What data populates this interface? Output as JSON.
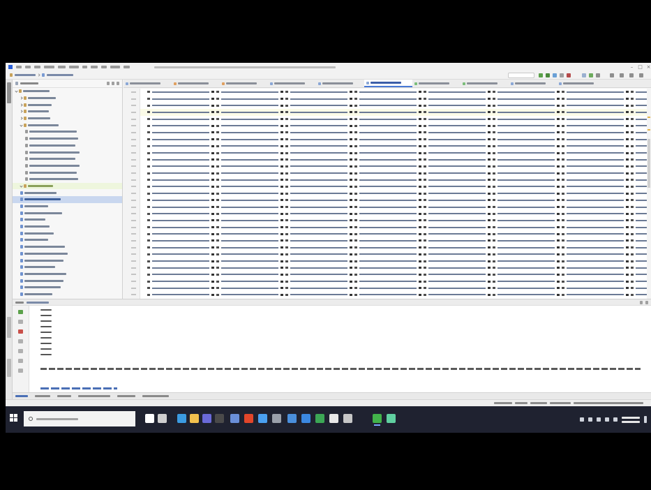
{
  "window": {
    "title": ""
  },
  "menu": {
    "items": [
      "",
      "",
      "",
      "",
      "",
      "",
      "",
      "",
      "",
      "",
      "",
      ""
    ]
  },
  "breadcrumb": [
    "",
    ""
  ],
  "project": {
    "header": "",
    "tree": [
      {
        "label": "",
        "depth": 0,
        "kind": "folder-open"
      },
      {
        "label": "",
        "depth": 1,
        "kind": "folder"
      },
      {
        "label": "",
        "depth": 1,
        "kind": "folder"
      },
      {
        "label": "",
        "depth": 1,
        "kind": "folder"
      },
      {
        "label": "",
        "depth": 1,
        "kind": "folder"
      },
      {
        "label": "",
        "depth": 1,
        "kind": "folder-open"
      },
      {
        "label": "",
        "depth": 2,
        "kind": "file"
      },
      {
        "label": "",
        "depth": 2,
        "kind": "file"
      },
      {
        "label": "",
        "depth": 2,
        "kind": "file"
      },
      {
        "label": "",
        "depth": 2,
        "kind": "file"
      },
      {
        "label": "",
        "depth": 2,
        "kind": "file"
      },
      {
        "label": "",
        "depth": 2,
        "kind": "file"
      },
      {
        "label": "",
        "depth": 2,
        "kind": "file"
      },
      {
        "label": "",
        "depth": 2,
        "kind": "file"
      },
      {
        "label": "",
        "depth": 1,
        "kind": "folder-open",
        "state": "highlight"
      },
      {
        "label": "",
        "depth": 1,
        "kind": "py"
      },
      {
        "label": "",
        "depth": 1,
        "kind": "py",
        "state": "selected"
      },
      {
        "label": "",
        "depth": 1,
        "kind": "py"
      },
      {
        "label": "",
        "depth": 1,
        "kind": "py"
      },
      {
        "label": "",
        "depth": 1,
        "kind": "py"
      },
      {
        "label": "",
        "depth": 1,
        "kind": "py"
      },
      {
        "label": "",
        "depth": 1,
        "kind": "py"
      },
      {
        "label": "",
        "depth": 1,
        "kind": "py"
      },
      {
        "label": "",
        "depth": 1,
        "kind": "py"
      },
      {
        "label": "",
        "depth": 1,
        "kind": "py"
      },
      {
        "label": "",
        "depth": 1,
        "kind": "py"
      },
      {
        "label": "",
        "depth": 1,
        "kind": "py"
      },
      {
        "label": "",
        "depth": 1,
        "kind": "py"
      },
      {
        "label": "",
        "depth": 1,
        "kind": "py"
      },
      {
        "label": "",
        "depth": 1,
        "kind": "py"
      },
      {
        "label": "",
        "depth": 1,
        "kind": "py"
      }
    ]
  },
  "editor": {
    "tabs": [
      {
        "label": "",
        "color": "#8aa7d6"
      },
      {
        "label": "",
        "color": "#e0a060"
      },
      {
        "label": "",
        "color": "#e0a060"
      },
      {
        "label": "",
        "color": "#8aa7d6"
      },
      {
        "label": "",
        "color": "#8aa7d6"
      },
      {
        "label": "",
        "color": "#8aa7d6",
        "active": true
      },
      {
        "label": "",
        "color": "#7bbd7a"
      },
      {
        "label": "",
        "color": "#7bbd7a"
      },
      {
        "label": "",
        "color": "#8aa7d6"
      },
      {
        "label": "",
        "color": "#8aa7d6"
      }
    ],
    "line_numbers": [
      "",
      "",
      "",
      "",
      "",
      "",
      "",
      "",
      "",
      "",
      "",
      "",
      "",
      "",
      "",
      "",
      "",
      "",
      "",
      "",
      "",
      "",
      "",
      "",
      "",
      "",
      "",
      "",
      "",
      "",
      ""
    ],
    "line_count": 31,
    "cursor_line": 3
  },
  "run": {
    "header": "",
    "output_lines": [
      "",
      "",
      "",
      "",
      "",
      "",
      "",
      "",
      ""
    ],
    "message": "",
    "exit_message": ""
  },
  "tool_windows": [
    "",
    "",
    "",
    "",
    "",
    ""
  ],
  "status": {
    "items": [
      "",
      "",
      "",
      "",
      ""
    ]
  },
  "taskbar": {
    "search_placeholder": "",
    "apps": [
      {
        "icon": "task-view-icon",
        "color": "#ffffff"
      },
      {
        "icon": "widgets-icon",
        "color": "#cfcfcf"
      },
      {
        "icon": "edge-icon",
        "color": "#3b9be0"
      },
      {
        "icon": "file-explorer-icon",
        "color": "#f2c14e"
      },
      {
        "icon": "teams-icon",
        "color": "#6a6ad8"
      },
      {
        "icon": "terminal-icon",
        "color": "#4a4a4a"
      },
      {
        "icon": "chrome-icon",
        "color": "#6a8fd8"
      },
      {
        "icon": "brave-icon",
        "color": "#e2462a"
      },
      {
        "icon": "vscode-icon",
        "color": "#4aa0f0"
      },
      {
        "icon": "store-icon",
        "color": "#9aa0aa"
      },
      {
        "icon": "photos-icon",
        "color": "#4a8fdc"
      },
      {
        "icon": "maps-icon",
        "color": "#3b88e0"
      },
      {
        "icon": "spotify-icon",
        "color": "#3ca755"
      },
      {
        "icon": "slack-icon",
        "color": "#e8e8e8"
      },
      {
        "icon": "settings-icon",
        "color": "#c6c6c6"
      },
      {
        "icon": "pycharm-icon",
        "color": "#42b34a",
        "active": true
      },
      {
        "icon": "globe-icon",
        "color": "#60d0a0"
      }
    ],
    "clock_time": "",
    "clock_date": ""
  }
}
